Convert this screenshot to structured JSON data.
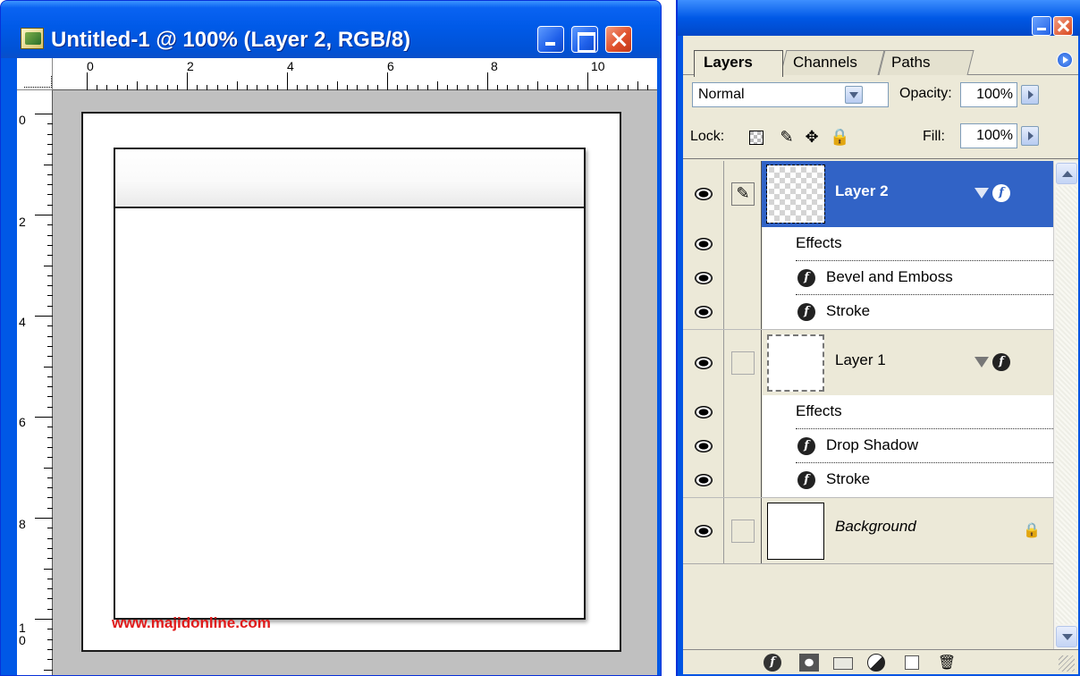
{
  "document_window": {
    "title": "Untitled-1 @ 100% (Layer 2, RGB/8)",
    "icon": "photoshop-document-icon",
    "ruler_top_labels": [
      "0",
      "2",
      "4",
      "6",
      "8",
      "10"
    ],
    "ruler_left_labels": [
      "0",
      "2",
      "4",
      "6",
      "8",
      "1",
      "0"
    ],
    "watermark": "www.majidonline.com",
    "accent_color": "#0058e6"
  },
  "layers_palette": {
    "tabs": [
      {
        "label": "Layers",
        "active": true
      },
      {
        "label": "Channels",
        "active": false
      },
      {
        "label": "Paths",
        "active": false
      }
    ],
    "blend_mode": "Normal",
    "opacity_label": "Opacity:",
    "opacity_value": "100%",
    "lock_label": "Lock:",
    "fill_label": "Fill:",
    "fill_value": "100%",
    "layers": [
      {
        "name": "Layer 2",
        "selected": true,
        "effects_label": "Effects",
        "effects": [
          "Bevel and Emboss",
          "Stroke"
        ]
      },
      {
        "name": "Layer 1",
        "selected": false,
        "effects_label": "Effects",
        "effects": [
          "Drop Shadow",
          "Stroke"
        ]
      },
      {
        "name": "Background",
        "selected": false,
        "locked": true
      }
    ],
    "selected_color": "#3163c6"
  }
}
